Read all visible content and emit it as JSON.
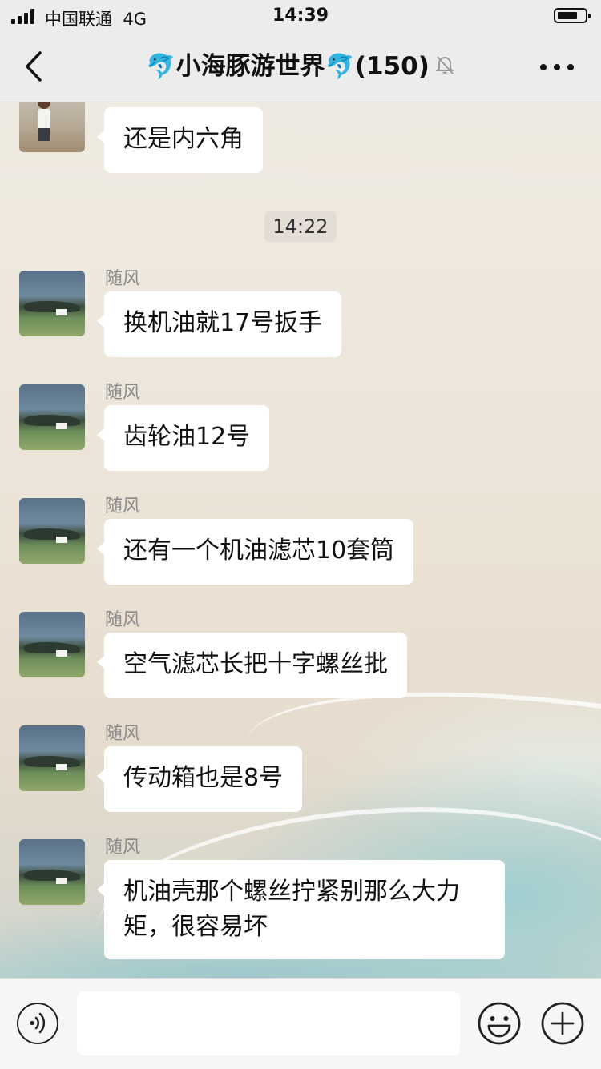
{
  "status_bar": {
    "carrier": "中国联通",
    "network": "4G",
    "time": "14:39"
  },
  "nav": {
    "title": "小海豚游世界",
    "title_emoji": "🐬",
    "member_count": "(150)"
  },
  "timestamp": "14:22",
  "messages": [
    {
      "sender": "",
      "text": "还是内六角",
      "avatar": "kid"
    },
    {
      "sender": "随风",
      "text": "换机油就17号扳手",
      "avatar": "landscape"
    },
    {
      "sender": "随风",
      "text": "齿轮油12号",
      "avatar": "landscape"
    },
    {
      "sender": "随风",
      "text": "还有一个机油滤芯10套筒",
      "avatar": "landscape"
    },
    {
      "sender": "随风",
      "text": "空气滤芯长把十字螺丝批",
      "avatar": "landscape"
    },
    {
      "sender": "随风",
      "text": "传动箱也是8号",
      "avatar": "landscape"
    },
    {
      "sender": "随风",
      "text": "机油壳那个螺丝拧紧别那么大力矩，很容易坏",
      "avatar": "landscape"
    }
  ],
  "input": {
    "value": "",
    "placeholder": ""
  },
  "icons": {
    "back": "chevron-left-icon",
    "mute": "bell-slash-icon",
    "more": "more-dots-icon",
    "voice": "voice-icon",
    "emoji": "emoji-icon",
    "plus": "plus-icon"
  }
}
